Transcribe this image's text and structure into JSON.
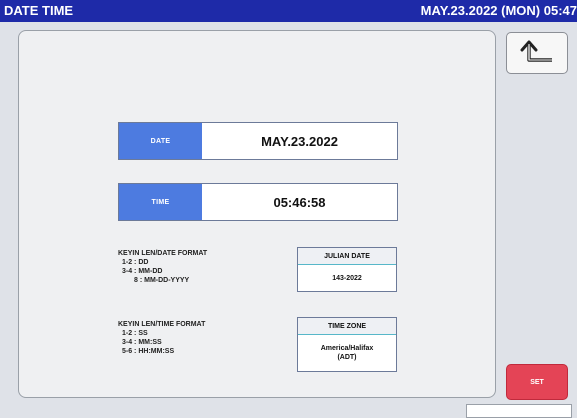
{
  "titlebar": {
    "title": "DATE TIME",
    "datetime": "MAY.23.2022 (MON) 05:47"
  },
  "date_field": {
    "label": "DATE",
    "value": "MAY.23.2022"
  },
  "time_field": {
    "label": "TIME",
    "value": "05:46:58"
  },
  "date_format": {
    "title": "KEYIN LEN/DATE FORMAT",
    "lines": [
      "1-2 : DD",
      "3-4 : MM-DD",
      "8 : MM-DD-YYYY"
    ]
  },
  "time_format": {
    "title": "KEYIN LEN/TIME FORMAT",
    "lines": [
      "1-2 : SS",
      "3-4 : MM:SS",
      "5-6 : HH:MM:SS"
    ]
  },
  "julian_date": {
    "title": "JULIAN DATE",
    "value": "143-2022"
  },
  "time_zone": {
    "title": "TIME ZONE",
    "value_line1": "America/Halifax",
    "value_line2": "(ADT)"
  },
  "buttons": {
    "back_icon": "return-arrow-icon",
    "set_label": "SET"
  },
  "colors": {
    "titlebar": "#1e2aa8",
    "field_label": "#4d7be0",
    "set_button": "#e44456"
  }
}
